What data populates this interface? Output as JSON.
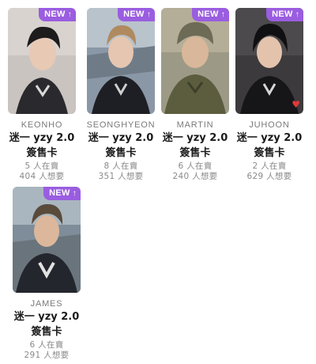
{
  "badge": {
    "label": "NEW",
    "arrow": "↑"
  },
  "cards": [
    {
      "member": "KEONHO",
      "title_line1": "迷一 yzy 2.0",
      "title_line2": "簽售卡",
      "selling": "5 人在賣",
      "wanting": "404 人想要",
      "favorited": false
    },
    {
      "member": "SEONGHYEON",
      "title_line1": "迷一 yzy 2.0",
      "title_line2": "簽售卡",
      "selling": "8 人在賣",
      "wanting": "351 人想要",
      "favorited": false
    },
    {
      "member": "MARTIN",
      "title_line1": "迷一 yzy 2.0",
      "title_line2": "簽售卡",
      "selling": "6 人在賣",
      "wanting": "240 人想要",
      "favorited": false
    },
    {
      "member": "JUHOON",
      "title_line1": "迷一 yzy 2.0",
      "title_line2": "簽售卡",
      "selling": "2 人在賣",
      "wanting": "629 人想要",
      "favorited": true
    },
    {
      "member": "JAMES",
      "title_line1": "迷一 yzy 2.0",
      "title_line2": "簽售卡",
      "selling": "6 人在賣",
      "wanting": "291 人想要",
      "favorited": false
    }
  ],
  "colors": {
    "badge": "#9a5de0",
    "heart": "#e23a3a",
    "member": "#7a7a7a",
    "stat": "#8a8a8a"
  }
}
